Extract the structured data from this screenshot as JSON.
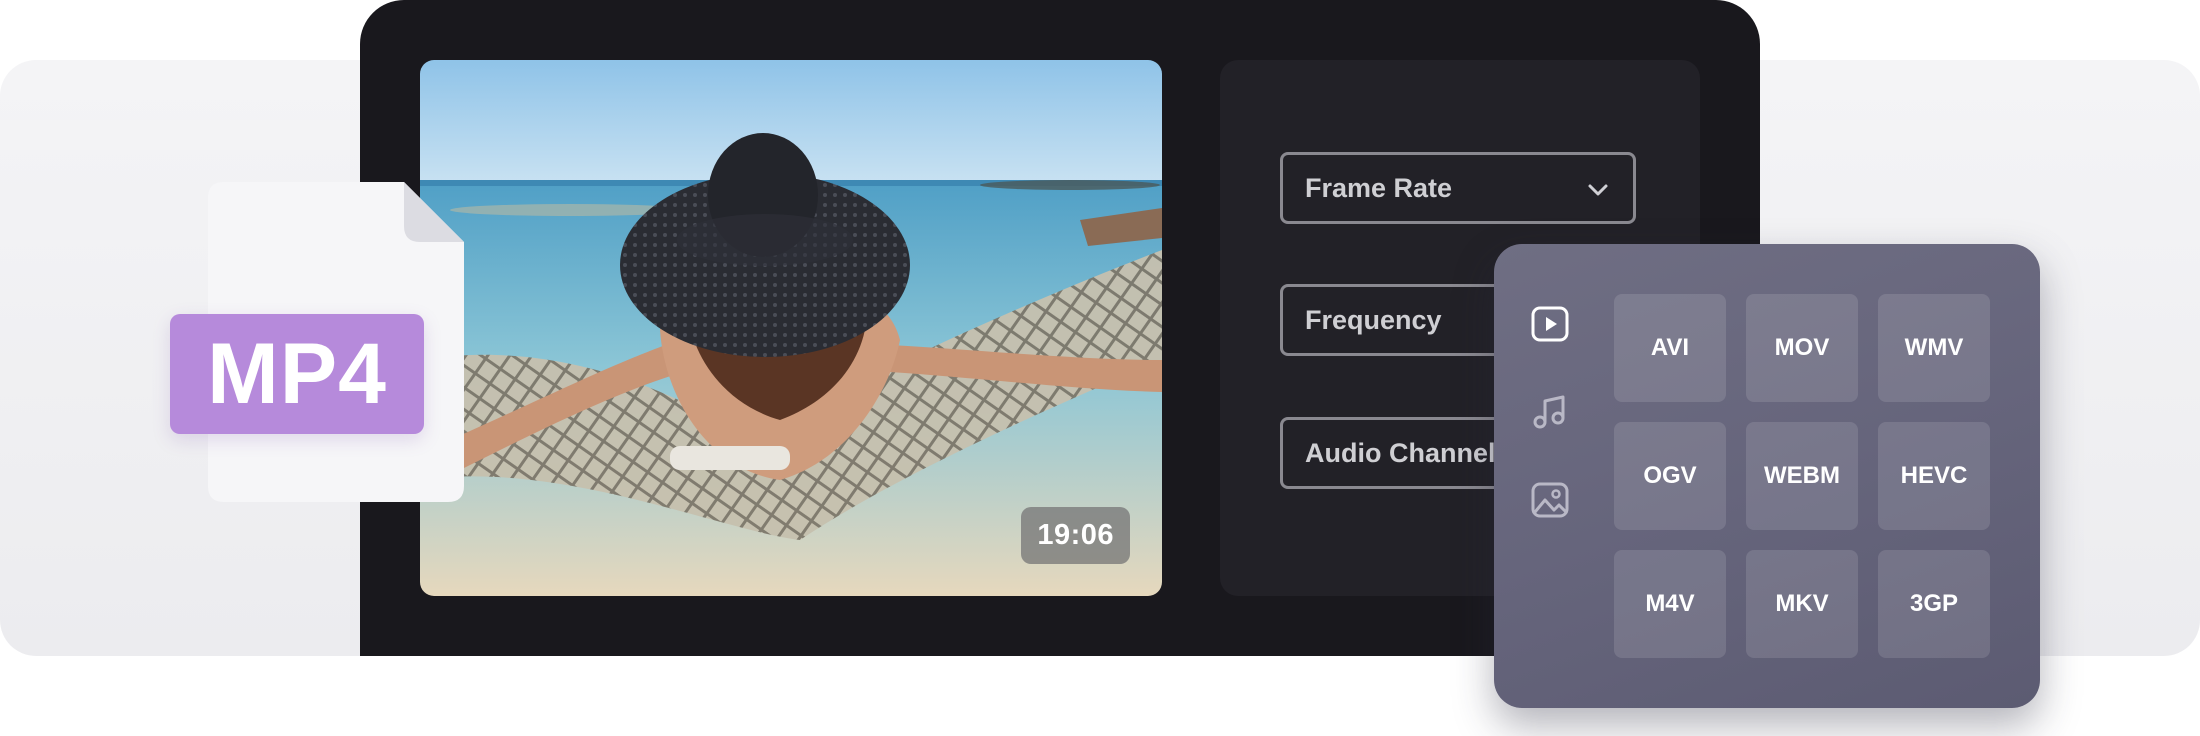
{
  "badge": {
    "text": "MP4"
  },
  "video": {
    "duration": "19:06"
  },
  "settings": {
    "frame_rate": "Frame Rate",
    "frequency": "Frequency",
    "audio_channel": "Audio Channel"
  },
  "formats": {
    "side_icons": [
      "play-icon",
      "music-note-icon",
      "image-icon"
    ],
    "items": [
      "AVI",
      "MOV",
      "WMV",
      "OGV",
      "WEBM",
      "HEVC",
      "M4V",
      "MKV",
      "3GP"
    ]
  },
  "colors": {
    "badge": "#b68adb",
    "device": "#19181d",
    "panel": "#222127",
    "format_panel": "#6a697f"
  }
}
